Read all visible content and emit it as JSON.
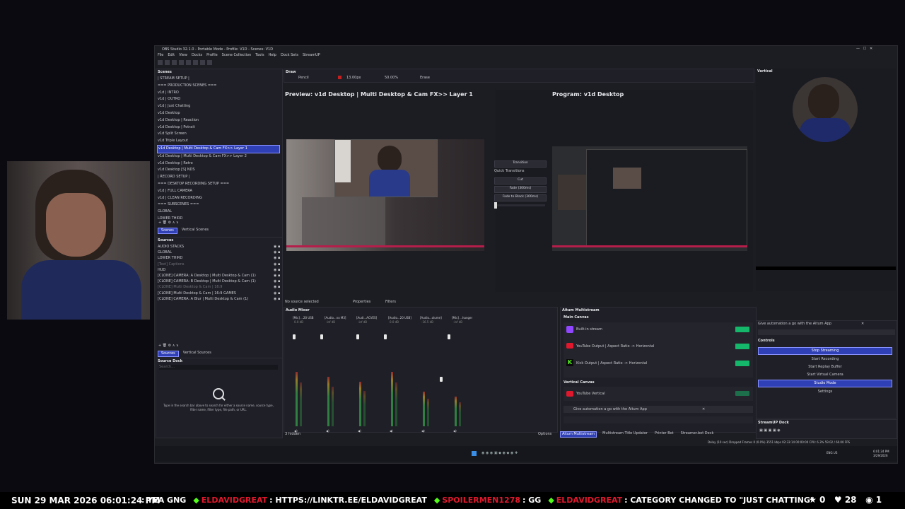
{
  "window_title": "OBS Studio 32.1.0 - Portable Mode - Profile: V1D - Scenes: V1D",
  "menu": [
    "File",
    "Edit",
    "View",
    "Docks",
    "Profile",
    "Scene Collection",
    "Tools",
    "Help",
    "Dock Sets",
    "StreamUP"
  ],
  "scenes_panel": {
    "title": "Scenes",
    "items": [
      "| STREAM SETUP |",
      "=== PRODUCTION SCENES ===",
      "v1d | INTRO",
      "v1d | OUTRO",
      "v1d | Just Chatting",
      "v1d Desktop",
      "v1d Desktop | Reaction",
      "v1d Desktop | Potrait",
      "v1d Split Screen",
      "v1d Triple Layout",
      "v1d Desktop | Multi Desktop & Cam FX>> Layer 1",
      "v1d Desktop | Multi Desktop & Cam FX>> Layer 2",
      "v1d Desktop | Retro",
      "v1d Desktop [S] NDS",
      "| RECORD SETUP |",
      "=== DESKTOP RECORDING SETUP ===",
      "v1d | FULL CAMERA",
      "v1d | CLEAN RECORDING",
      "=== SUBSCENES ===",
      "GLOBAL",
      "LOWER THIRD"
    ],
    "selected_index": 10,
    "tabs": [
      "Scenes",
      "Vertical Scenes"
    ]
  },
  "sources_panel": {
    "title": "Sources",
    "items": [
      "AUDIO STACKS",
      "GLOBAL",
      "LOWER THIRD",
      "[Text] Captions",
      "HUD",
      "[CLONE] CAMERA: A Desktop | Multi Desktop & Cam (1)",
      "[CLONE] CAMERA: B Desktop | Multi Desktop & Cam (1)",
      "[CLONE] Multi Desktop & Cam | 16:9",
      "[CLONE] Multi Desktop & Cam | 16:9 GAMES",
      "[CLONE] CAMERA: A Blur | Multi Desktop & Cam (1)"
    ],
    "tabs": [
      "Sources",
      "Vertical Sources"
    ]
  },
  "source_dock": {
    "title": "Source Dock",
    "search_placeholder": "Search...",
    "hint": "Type in the search bar above to search for either a source name, source type, filter name, filter type, file path, or URL."
  },
  "draw_toolbar": {
    "title": "Draw",
    "tool": "Pencil",
    "size": "13.00px",
    "opacity": "50.00%",
    "erase": "Erase"
  },
  "preview_title": "Preview: v1d Desktop | Multi Desktop & Cam FX>> Layer 1",
  "program_title": "Program: v1d Desktop",
  "transition": {
    "label": "Transition",
    "quick": "Quick Transitions",
    "cut": "Cut",
    "fade": "Fade (300ms)",
    "fade_black": "Fade to Black (300ms)"
  },
  "source_bar": {
    "no_source": "No source selected",
    "properties": "Properties",
    "filters": "Filters"
  },
  "audio_mixer": {
    "title": "Audio Mixer",
    "channels": [
      {
        "name": "[Mic] ...20 USB",
        "db": "0.0 dB",
        "level": 0.55
      },
      {
        "name": "[Audio...no M3]",
        "db": "-inf dB",
        "level": 0.5
      },
      {
        "name": "[Audi...ACVES]",
        "db": "-inf dB",
        "level": 0.45
      },
      {
        "name": "[Audio...20 USB]",
        "db": "0.0 dB",
        "level": 0.55
      },
      {
        "name": "[Audio...olume]",
        "db": "-16.5 dB",
        "level": 0.35
      },
      {
        "name": "[Mic] ...hanger",
        "db": "-inf dB",
        "level": 0.3
      }
    ],
    "hidden": "3 hidden",
    "options": "Options"
  },
  "aitum": {
    "title": "Aitum Multistream",
    "main_canvas": "Main Canvas",
    "outputs": [
      "Built-in stream",
      "YouTube Output | Aspect Ratio -> Horizontal",
      "Kick Output | Aspect Ratio -> Horizontal"
    ],
    "vertical_canvas": "Vertical Canvas",
    "vertical_outputs": [
      "YouTube Vertical"
    ],
    "automation": "Give automation a go with the Aitum App"
  },
  "bottom_tabs": [
    "Aitum Multistream",
    "Multistream Title Updater",
    "Printer Bot",
    "Streamer.bot Deck"
  ],
  "vertical": {
    "title": "Vertical",
    "automation": "Give automation a go with the Aitum App",
    "controls_title": "Controls",
    "controls": [
      "Stop Streaming",
      "Start Recording",
      "Start Replay Buffer",
      "Start Virtual Camera",
      "Studio Mode",
      "Settings"
    ]
  },
  "streamup_dock": "StreamUP Dock",
  "status_bar": "Delay (10 sec)  Dropped Frames 0 (0.0%)   3551 kbps   02:33:14   00:00:00   CPU: 6.3% 59.02 / 60.00 FPS",
  "taskbar": {
    "lang": "ENG US",
    "time": "6:01:24 PM",
    "date": "3/29/2026"
  },
  "ticker": {
    "datetime": "SUN 29 MAR 2026 06:01:24 PM",
    "segments": [
      {
        "user": "",
        "text": ": YEA GNG"
      },
      {
        "user": "ELDAVIDGREAT",
        "text": ": HTTPS://LINKTR.EE/ELDAVIDGREAT"
      },
      {
        "user": "SPOILERMEN1278",
        "text": ": GG"
      },
      {
        "user": "ELDAVIDGREAT",
        "text": ": CATEGORY CHANGED TO \"JUST CHATTING\""
      }
    ],
    "stars": "0",
    "hearts": "28",
    "viewers": "1"
  },
  "colors": {
    "accent": "#2f3fb5",
    "green": "#15b86a",
    "brand_red": "#e0182d",
    "twitch": "#9146ff",
    "kick": "#53fc18"
  }
}
